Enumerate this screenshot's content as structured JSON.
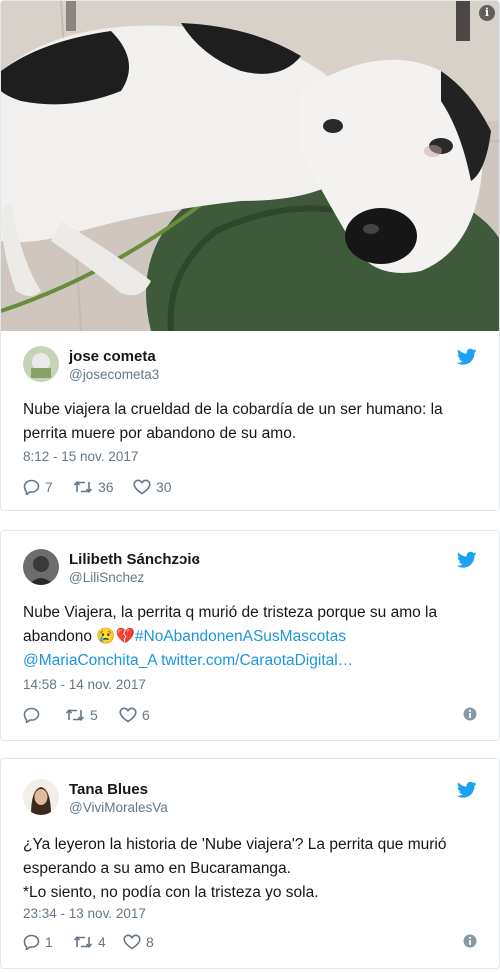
{
  "tweets": [
    {
      "name": "jose cometa",
      "handle": "@josecometa3",
      "text": "Nube viajera la crueldad de la cobardía de un ser humano: la perrita muere por abandono de su amo.",
      "timestamp": "8:12 - 15 nov. 2017",
      "replies": "7",
      "retweets": "36",
      "likes": "30"
    },
    {
      "name": "Lilibeth Sánchzɔiɞ",
      "handle": "@LiliSnchez",
      "text": "Nube Viajera, la perrita q murió de tristeza porque su amo la abandono",
      "emoji": "😢💔",
      "hashtag": "#NoAbandonenASusMascotas",
      "mention": "@MariaConchita_A",
      "url": "twitter.com/CaraotaDigital…",
      "timestamp": "14:58 - 14 nov. 2017",
      "replies": "",
      "retweets": "5",
      "likes": "6"
    },
    {
      "name": "Tana Blues",
      "handle": "@ViviMoralesVa",
      "text_line1": "¿Ya leyeron la historia de 'Nube viajera'? La perrita que murió",
      "text_line2": "esperando a su amo en Bucaramanga.",
      "text_line3": "*Lo siento, no podía con la tristeza yo sola.",
      "timestamp": "23:34 - 13 nov. 2017",
      "replies": "1",
      "retweets": "4",
      "likes": "8"
    }
  ],
  "photo_badge": "i",
  "colors": {
    "twitter_blue": "#1da1f2",
    "link": "#1b95e0",
    "muted": "#657786",
    "border": "#e1e8ed"
  }
}
